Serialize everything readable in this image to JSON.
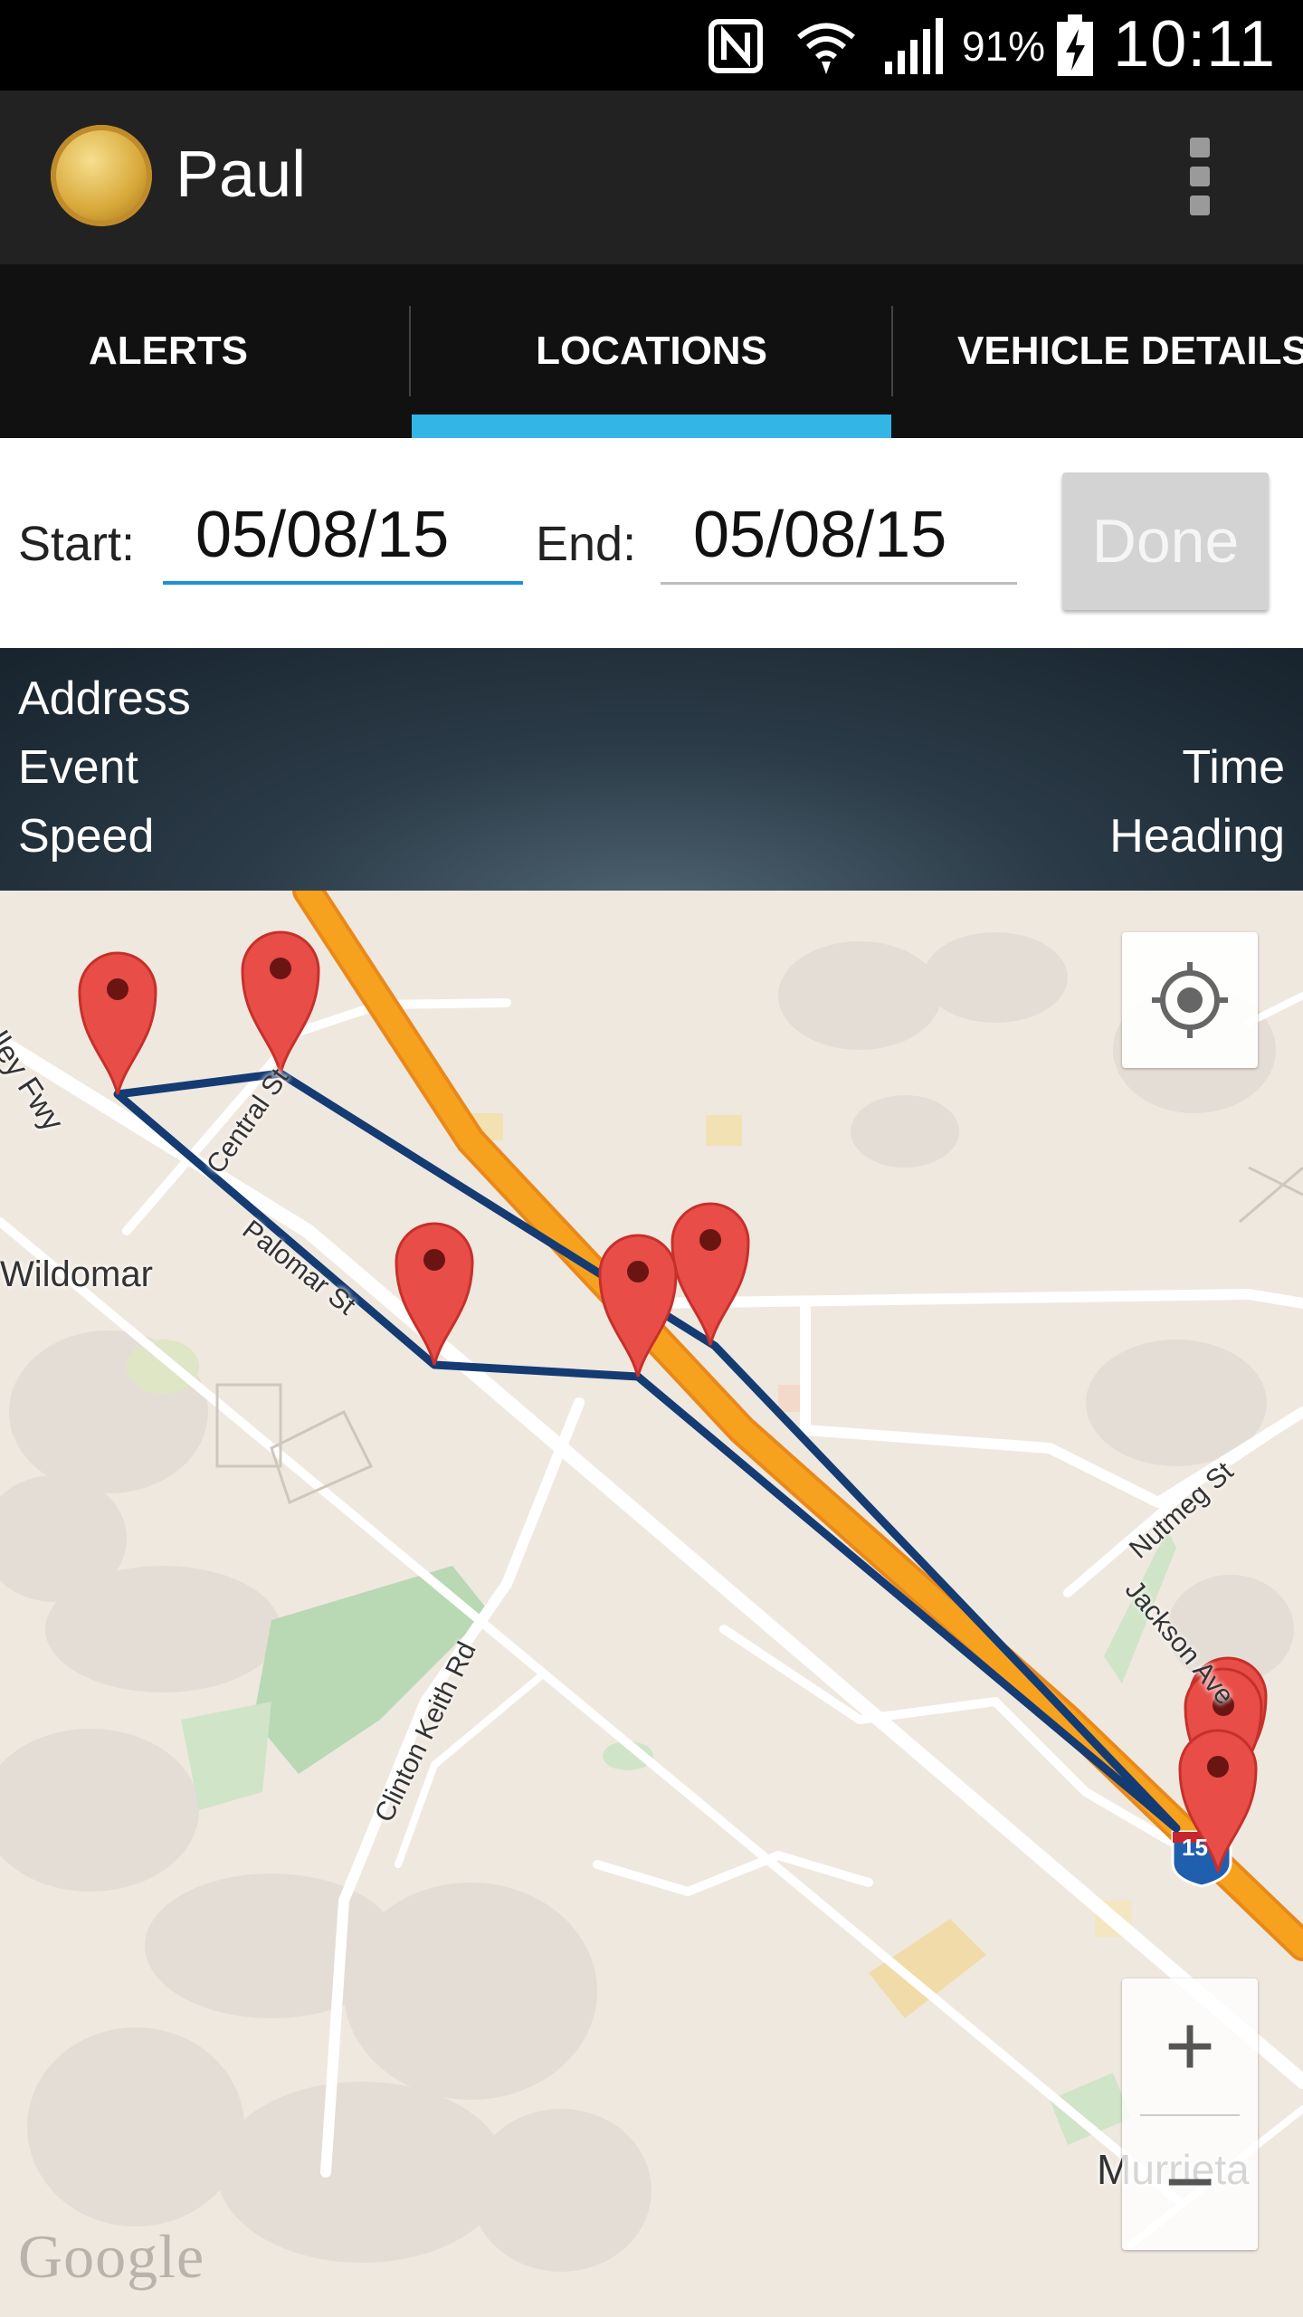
{
  "status_bar": {
    "battery": "91%",
    "time": "10:11"
  },
  "app_bar": {
    "title": "Paul"
  },
  "tabs": [
    {
      "label": "ALERTS",
      "selected": false
    },
    {
      "label": "LOCATIONS",
      "selected": true
    },
    {
      "label": "VEHICLE DETAILS",
      "selected": false
    }
  ],
  "date_range": {
    "start_label": "Start:",
    "start_value": "05/08/15",
    "end_label": "End:",
    "end_value": "05/08/15",
    "done_label": "Done"
  },
  "location_header": {
    "address": "Address",
    "event": "Event",
    "time": "Time",
    "speed": "Speed",
    "heading": "Heading"
  },
  "map": {
    "place_labels": {
      "wildomar": "Wildomar",
      "murrieta": "Murrieta"
    },
    "road_labels": {
      "freeway": "ecula Valley Fwy",
      "central": "Central St",
      "palomar": "Palomar St",
      "clinton": "Clinton Keith Rd",
      "nutmeg": "Nutmeg St",
      "jackson": "Jackson Ave"
    },
    "shield": "15",
    "attribution": "Google",
    "zoom_in": "+",
    "zoom_out": "−",
    "route_color": "#153b73",
    "marker_color": "#e84d48",
    "freeway_color": "#f7a21e"
  }
}
